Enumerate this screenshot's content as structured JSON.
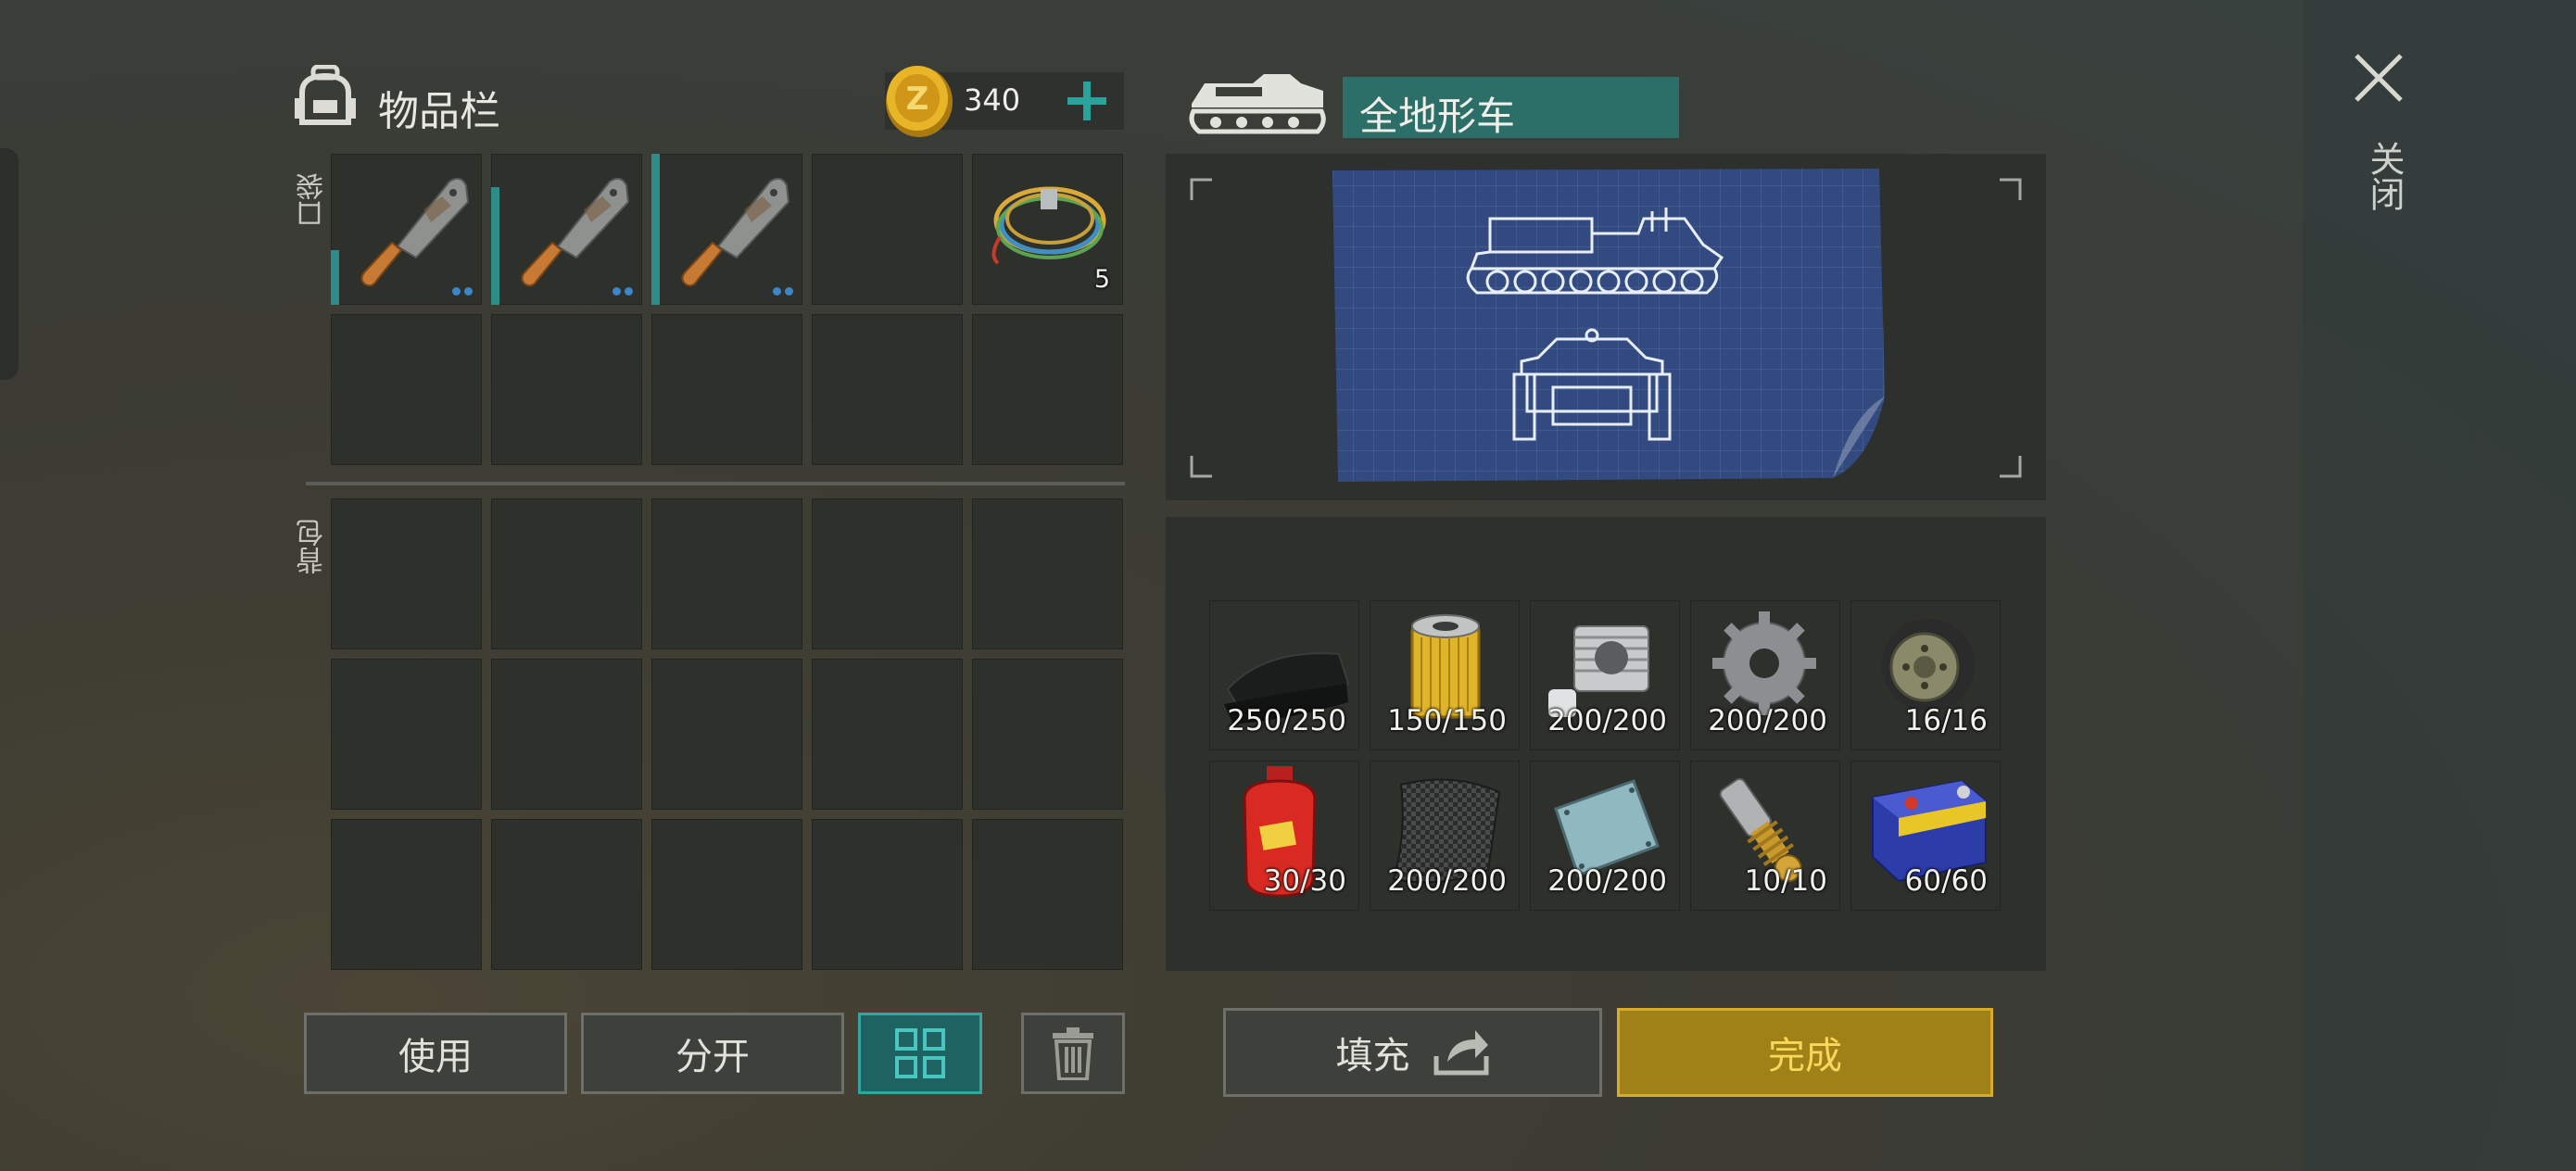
{
  "inventory": {
    "title": "物品栏",
    "coins": "340",
    "pocket_label": "口袋",
    "backpack_label": "背包",
    "pocket_items": [
      {
        "name": "cleaver",
        "durability_pct": 35,
        "dots": [
          "#2a2f33",
          "#3d86c8",
          "#3d86c8"
        ]
      },
      {
        "name": "cleaver",
        "durability_pct": 78,
        "dots": [
          "#2a2f33",
          "#3d86c8",
          "#3d86c8"
        ]
      },
      {
        "name": "cleaver",
        "durability_pct": 100,
        "dots": [
          "#2a2f33",
          "#3d86c8",
          "#3d86c8"
        ]
      },
      {
        "name": "empty"
      },
      {
        "name": "wire-coil",
        "count": "5"
      }
    ]
  },
  "vehicle": {
    "title": "全地形车",
    "materials": [
      {
        "icon": "rubber-sheet-icon",
        "qty": "250/250"
      },
      {
        "icon": "oil-filter-icon",
        "qty": "150/150"
      },
      {
        "icon": "engine-cylinder-icon",
        "qty": "200/200"
      },
      {
        "icon": "gear-icon",
        "qty": "200/200"
      },
      {
        "icon": "wheel-icon",
        "qty": "16/16"
      },
      {
        "icon": "gas-cylinder-icon",
        "qty": "30/30"
      },
      {
        "icon": "carbon-fiber-icon",
        "qty": "200/200"
      },
      {
        "icon": "metal-plate-icon",
        "qty": "200/200"
      },
      {
        "icon": "shock-absorber-icon",
        "qty": "10/10"
      },
      {
        "icon": "battery-icon",
        "qty": "60/60"
      }
    ]
  },
  "buttons": {
    "use": "使用",
    "split": "分开",
    "fill": "填充",
    "complete": "完成",
    "close": "关闭"
  },
  "colors": {
    "teal_accent": "#2b8c88",
    "gold_button": "#a08118",
    "title_box": "#2c6e68"
  }
}
